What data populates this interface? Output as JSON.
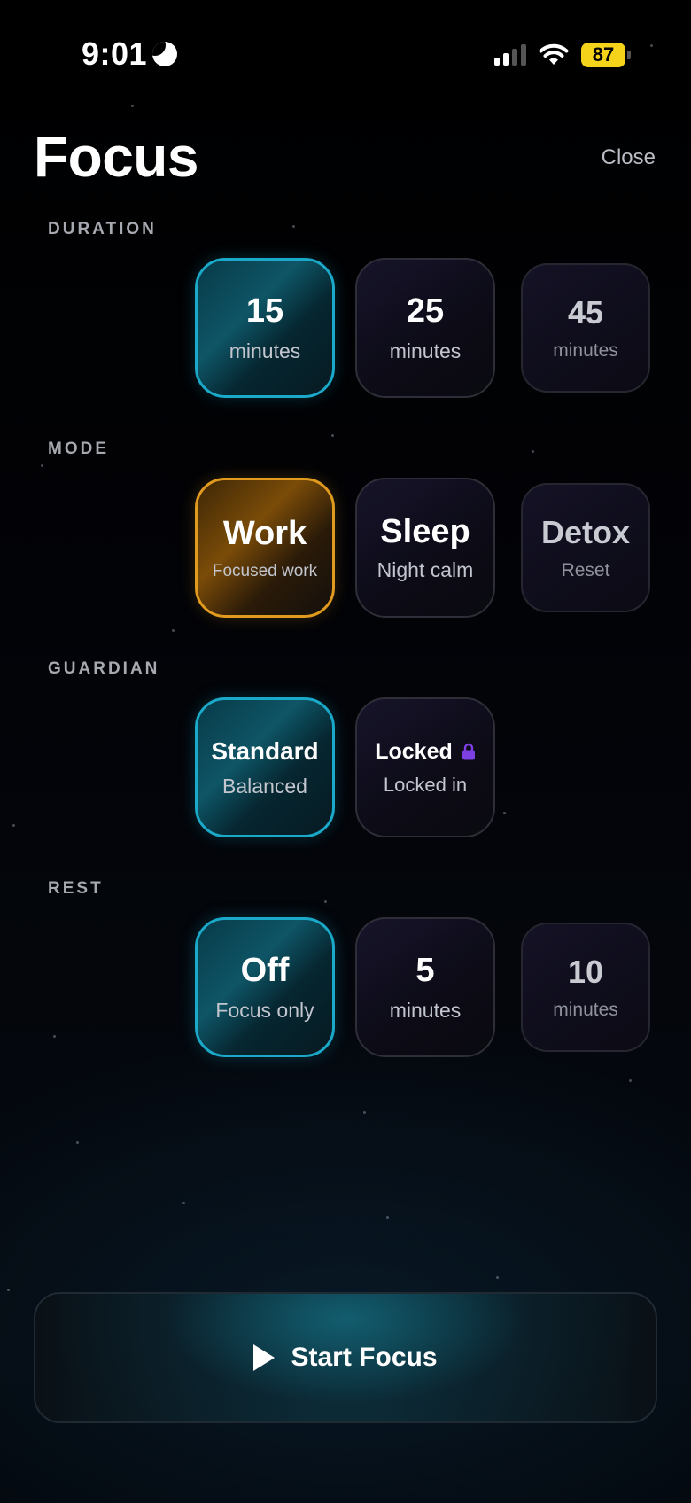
{
  "status_bar": {
    "time": "9:01",
    "battery": "87"
  },
  "header": {
    "title": "Focus",
    "close_label": "Close"
  },
  "sections": {
    "duration": {
      "label": "DURATION",
      "options": [
        {
          "main": "15",
          "sub": "minutes",
          "selected": true
        },
        {
          "main": "25",
          "sub": "minutes",
          "selected": false
        },
        {
          "main": "45",
          "sub": "minutes",
          "selected": false
        }
      ]
    },
    "mode": {
      "label": "MODE",
      "options": [
        {
          "main": "Work",
          "sub": "Focused work",
          "selected": true
        },
        {
          "main": "Sleep",
          "sub": "Night calm",
          "selected": false
        },
        {
          "main": "Detox",
          "sub": "Reset",
          "selected": false
        }
      ]
    },
    "guardian": {
      "label": "GUARDIAN",
      "options": [
        {
          "main": "Standard",
          "sub": "Balanced",
          "selected": true
        },
        {
          "main": "Locked",
          "sub": "Locked in",
          "selected": false
        }
      ]
    },
    "rest": {
      "label": "REST",
      "options": [
        {
          "main": "Off",
          "sub": "Focus only",
          "selected": true
        },
        {
          "main": "5",
          "sub": "minutes",
          "selected": false
        },
        {
          "main": "10",
          "sub": "minutes",
          "selected": false
        }
      ]
    }
  },
  "start_button": {
    "label": "Start Focus"
  },
  "colors": {
    "accent_teal": "#1aa9c8",
    "accent_amber": "#e09a1e",
    "lock_purple": "#7b3fe4",
    "battery_yellow": "#f5d31a"
  }
}
